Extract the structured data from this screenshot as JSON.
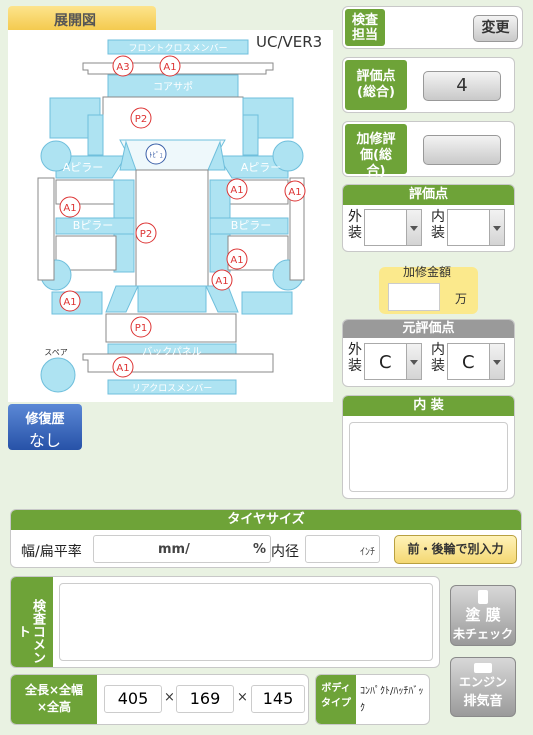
{
  "diagram": {
    "tab_label": "展開図",
    "version": "UC/VER3",
    "parts": {
      "front_cross_member": "フロントクロスメンバー",
      "core_support": "コアサポ",
      "a_pillar_left": "Aピラー",
      "a_pillar_right": "Aピラー",
      "b_pillar_left": "Bピラー",
      "b_pillar_right": "Bピラー",
      "back_panel": "バックパネル",
      "rear_cross_member": "リアクロスメンバー",
      "spare": "スペア",
      "pillar_mark": "ﾄﾋﾟｭ"
    },
    "marks": [
      "A3",
      "A1",
      "P2",
      "A1",
      "A1",
      "A1",
      "P2",
      "A1",
      "A1",
      "A1",
      "P1",
      "A1"
    ]
  },
  "repair_history": {
    "title": "修復歴",
    "value": "なし"
  },
  "inspector": {
    "label": "検査担当",
    "change_button": "変更"
  },
  "overall_score": {
    "label": "評価点(総合)",
    "value": "4"
  },
  "repair_score": {
    "label": "加修評価(総合)",
    "value": ""
  },
  "score": {
    "header": "評価点",
    "exterior_label": "外装",
    "interior_label": "内装",
    "exterior_value": "",
    "interior_value": ""
  },
  "repair_amount": {
    "label": "加修金額",
    "value": "",
    "unit": "万"
  },
  "original_score": {
    "header": "元評価点",
    "exterior_label": "外装",
    "interior_label": "内装",
    "exterior_value": "C",
    "interior_value": "C"
  },
  "interior": {
    "header": "内 装",
    "value": ""
  },
  "tire": {
    "header": "タイヤサイズ",
    "width_label": "幅/扁平率",
    "unit_mm": "mm/",
    "unit_pct": "%",
    "inner_label": "内径",
    "inch_unit": "ｲﾝﾁ",
    "separate_button": "前・後輪で別入力"
  },
  "comment": {
    "label": "検査コメント",
    "value": ""
  },
  "paint_button": {
    "line1": "塗 膜",
    "line2": "未チェック"
  },
  "engine_button": {
    "line1": "エンジン",
    "line2": "排気音"
  },
  "dimensions": {
    "label": "全長×全幅×全高",
    "length": "405",
    "width": "169",
    "height": "145",
    "sep": "×"
  },
  "body_type": {
    "label": "ボディタイプ",
    "value": "ｺﾝﾊﾟｸﾄ/ﾊｯﾁﾊﾞｯｸ"
  }
}
